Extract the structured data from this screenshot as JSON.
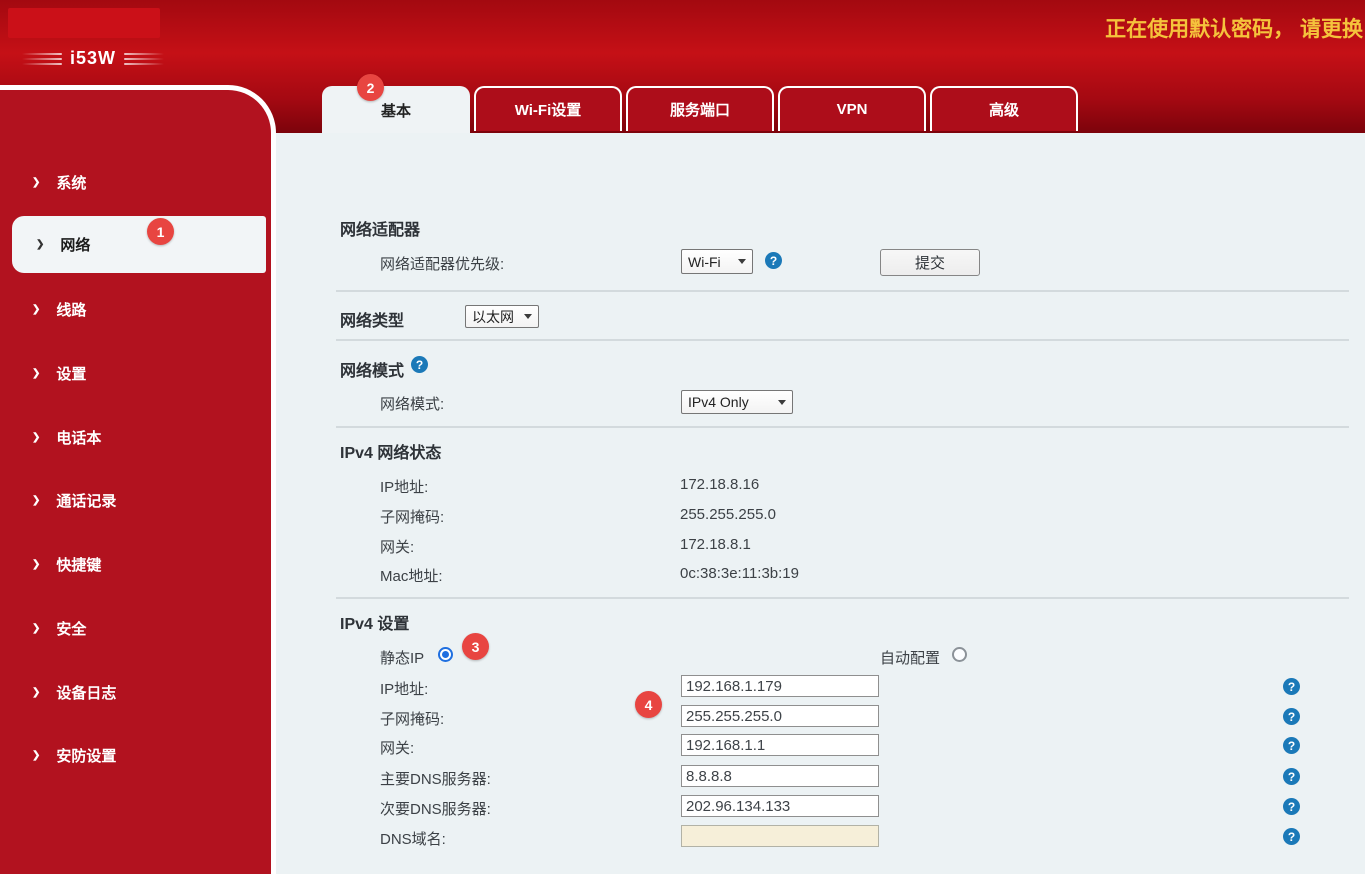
{
  "header": {
    "logo_text": "i53W",
    "warning": "正在使用默认密码， 请更换"
  },
  "sidebar": {
    "items": [
      {
        "label": "系统"
      },
      {
        "label": "网络",
        "active": true,
        "badge": "1"
      },
      {
        "label": "线路"
      },
      {
        "label": "设置"
      },
      {
        "label": "电话本"
      },
      {
        "label": "通话记录"
      },
      {
        "label": "快捷键"
      },
      {
        "label": "安全"
      },
      {
        "label": "设备日志"
      },
      {
        "label": "安防设置"
      }
    ]
  },
  "tabs": {
    "items": [
      {
        "label": "基本",
        "active": true,
        "badge": "2"
      },
      {
        "label": "Wi-Fi设置"
      },
      {
        "label": "服务端口"
      },
      {
        "label": "VPN"
      },
      {
        "label": "高级"
      }
    ]
  },
  "annotations": {
    "n1": "1",
    "n2": "2",
    "n3": "3",
    "n4": "4"
  },
  "sections": {
    "adapter": {
      "title": "网络适配器",
      "priority_label": "网络适配器优先级:",
      "priority_value": "Wi-Fi",
      "submit_label": "提交"
    },
    "net_type": {
      "label": "网络类型",
      "value": "以太网"
    },
    "net_mode": {
      "title": "网络模式",
      "label": "网络模式:",
      "value": "IPv4 Only"
    },
    "ipv4_status": {
      "title": "IPv4 网络状态",
      "rows": [
        {
          "label": "IP地址:",
          "value": "172.18.8.16"
        },
        {
          "label": "子网掩码:",
          "value": "255.255.255.0"
        },
        {
          "label": "网关:",
          "value": "172.18.8.1"
        },
        {
          "label": "Mac地址:",
          "value": "0c:38:3e:11:3b:19"
        }
      ]
    },
    "ipv4_settings": {
      "title": "IPv4 设置",
      "static_label": "静态IP",
      "auto_label": "自动配置",
      "fields": [
        {
          "label": "IP地址:",
          "value": "192.168.1.179"
        },
        {
          "label": "子网掩码:",
          "value": "255.255.255.0"
        },
        {
          "label": "网关:",
          "value": "192.168.1.1"
        },
        {
          "label": "主要DNS服务器:",
          "value": "8.8.8.8"
        },
        {
          "label": "次要DNS服务器:",
          "value": "202.96.134.133"
        },
        {
          "label": "DNS域名:",
          "value": ""
        }
      ]
    }
  },
  "colors": {
    "header_red": "#b20d16",
    "sidebar_red": "#b2121f",
    "tab_red": "#ad0d1a",
    "badge_red": "#e84541",
    "warning_gold": "#f5c33c",
    "help_blue": "#1b79b8",
    "content_bg": "#ecf2f4",
    "radio_blue": "#1f6fe0",
    "disabled_field_bg": "#f6efd9"
  }
}
